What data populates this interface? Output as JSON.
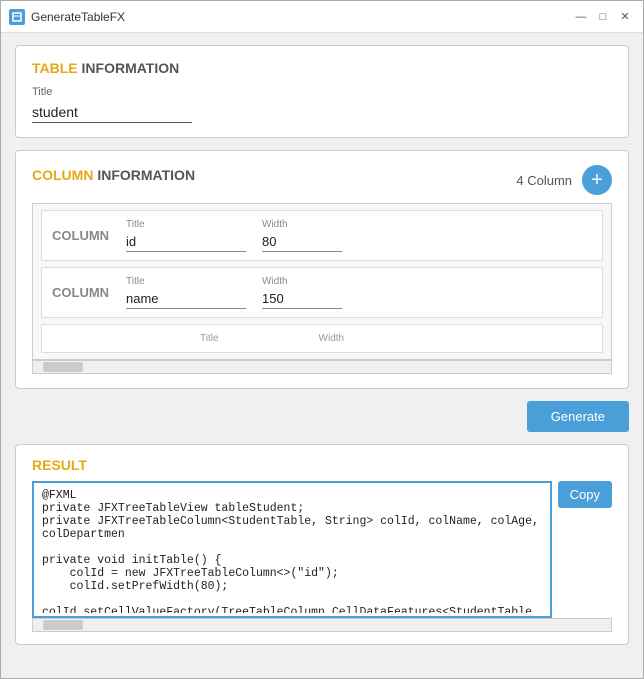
{
  "window": {
    "title": "GenerateTableFX",
    "controls": {
      "minimize": "—",
      "maximize": "□",
      "close": "✕"
    }
  },
  "table_info": {
    "section_title_highlight": "TABLE",
    "section_title_rest": " INFORMATION",
    "label": "Title",
    "value": "student",
    "placeholder": "Title"
  },
  "column_info": {
    "section_title_highlight": "COLUMN",
    "section_title_rest": " INFORMATION",
    "count_label": "4 Column",
    "add_button_label": "+",
    "columns": [
      {
        "label": "COLUMN",
        "title_label": "Title",
        "title_value": "id",
        "width_label": "Width",
        "width_value": "80"
      },
      {
        "label": "COLUMN",
        "title_label": "Title",
        "title_value": "name",
        "width_label": "Width",
        "width_value": "150"
      }
    ],
    "empty_row": {
      "title_label": "Title",
      "width_label": "Width"
    }
  },
  "generate_button": "Generate",
  "result": {
    "section_title": "RESULT",
    "code": "@FXML\nprivate JFXTreeTableView tableStudent;\nprivate JFXTreeTableColumn<StudentTable, String> colId, colName, colAge, colDepartmen\n\nprivate void initTable() {\n    colId = new JFXTreeTableColumn<>(\"id\");\n    colId.setPrefWidth(80);\n    colId.setCellValueFactory(TreeTableColumn.CellDataFeatures<StudentTable, String> c",
    "copy_button": "Copy"
  }
}
